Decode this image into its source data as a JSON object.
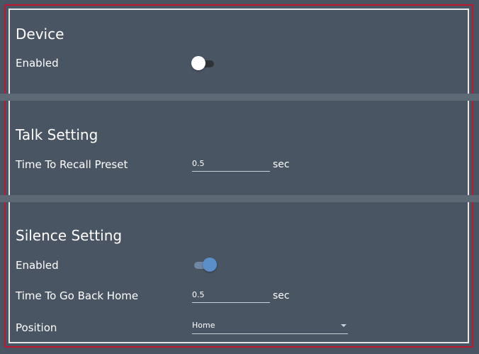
{
  "device": {
    "title": "Device",
    "enabled_label": "Enabled",
    "enabled": false
  },
  "talk_setting": {
    "title": "Talk Setting",
    "recall_label": "Time To Recall Preset",
    "recall_value": "0.5",
    "recall_unit": "sec"
  },
  "silence_setting": {
    "title": "Silence Setting",
    "enabled_label": "Enabled",
    "enabled": true,
    "go_home_label": "Time To Go Back Home",
    "go_home_value": "0.5",
    "go_home_unit": "sec",
    "position_label": "Position",
    "position_value": "Home"
  },
  "colors": {
    "background": "#4a5563",
    "divider": "#5d6a75",
    "frame_outer": "#c0182e",
    "frame_inner": "#e8e8e8",
    "toggle_on": "#5b8fc9"
  },
  "icons": {
    "dropdown": "chevron-down-icon"
  }
}
